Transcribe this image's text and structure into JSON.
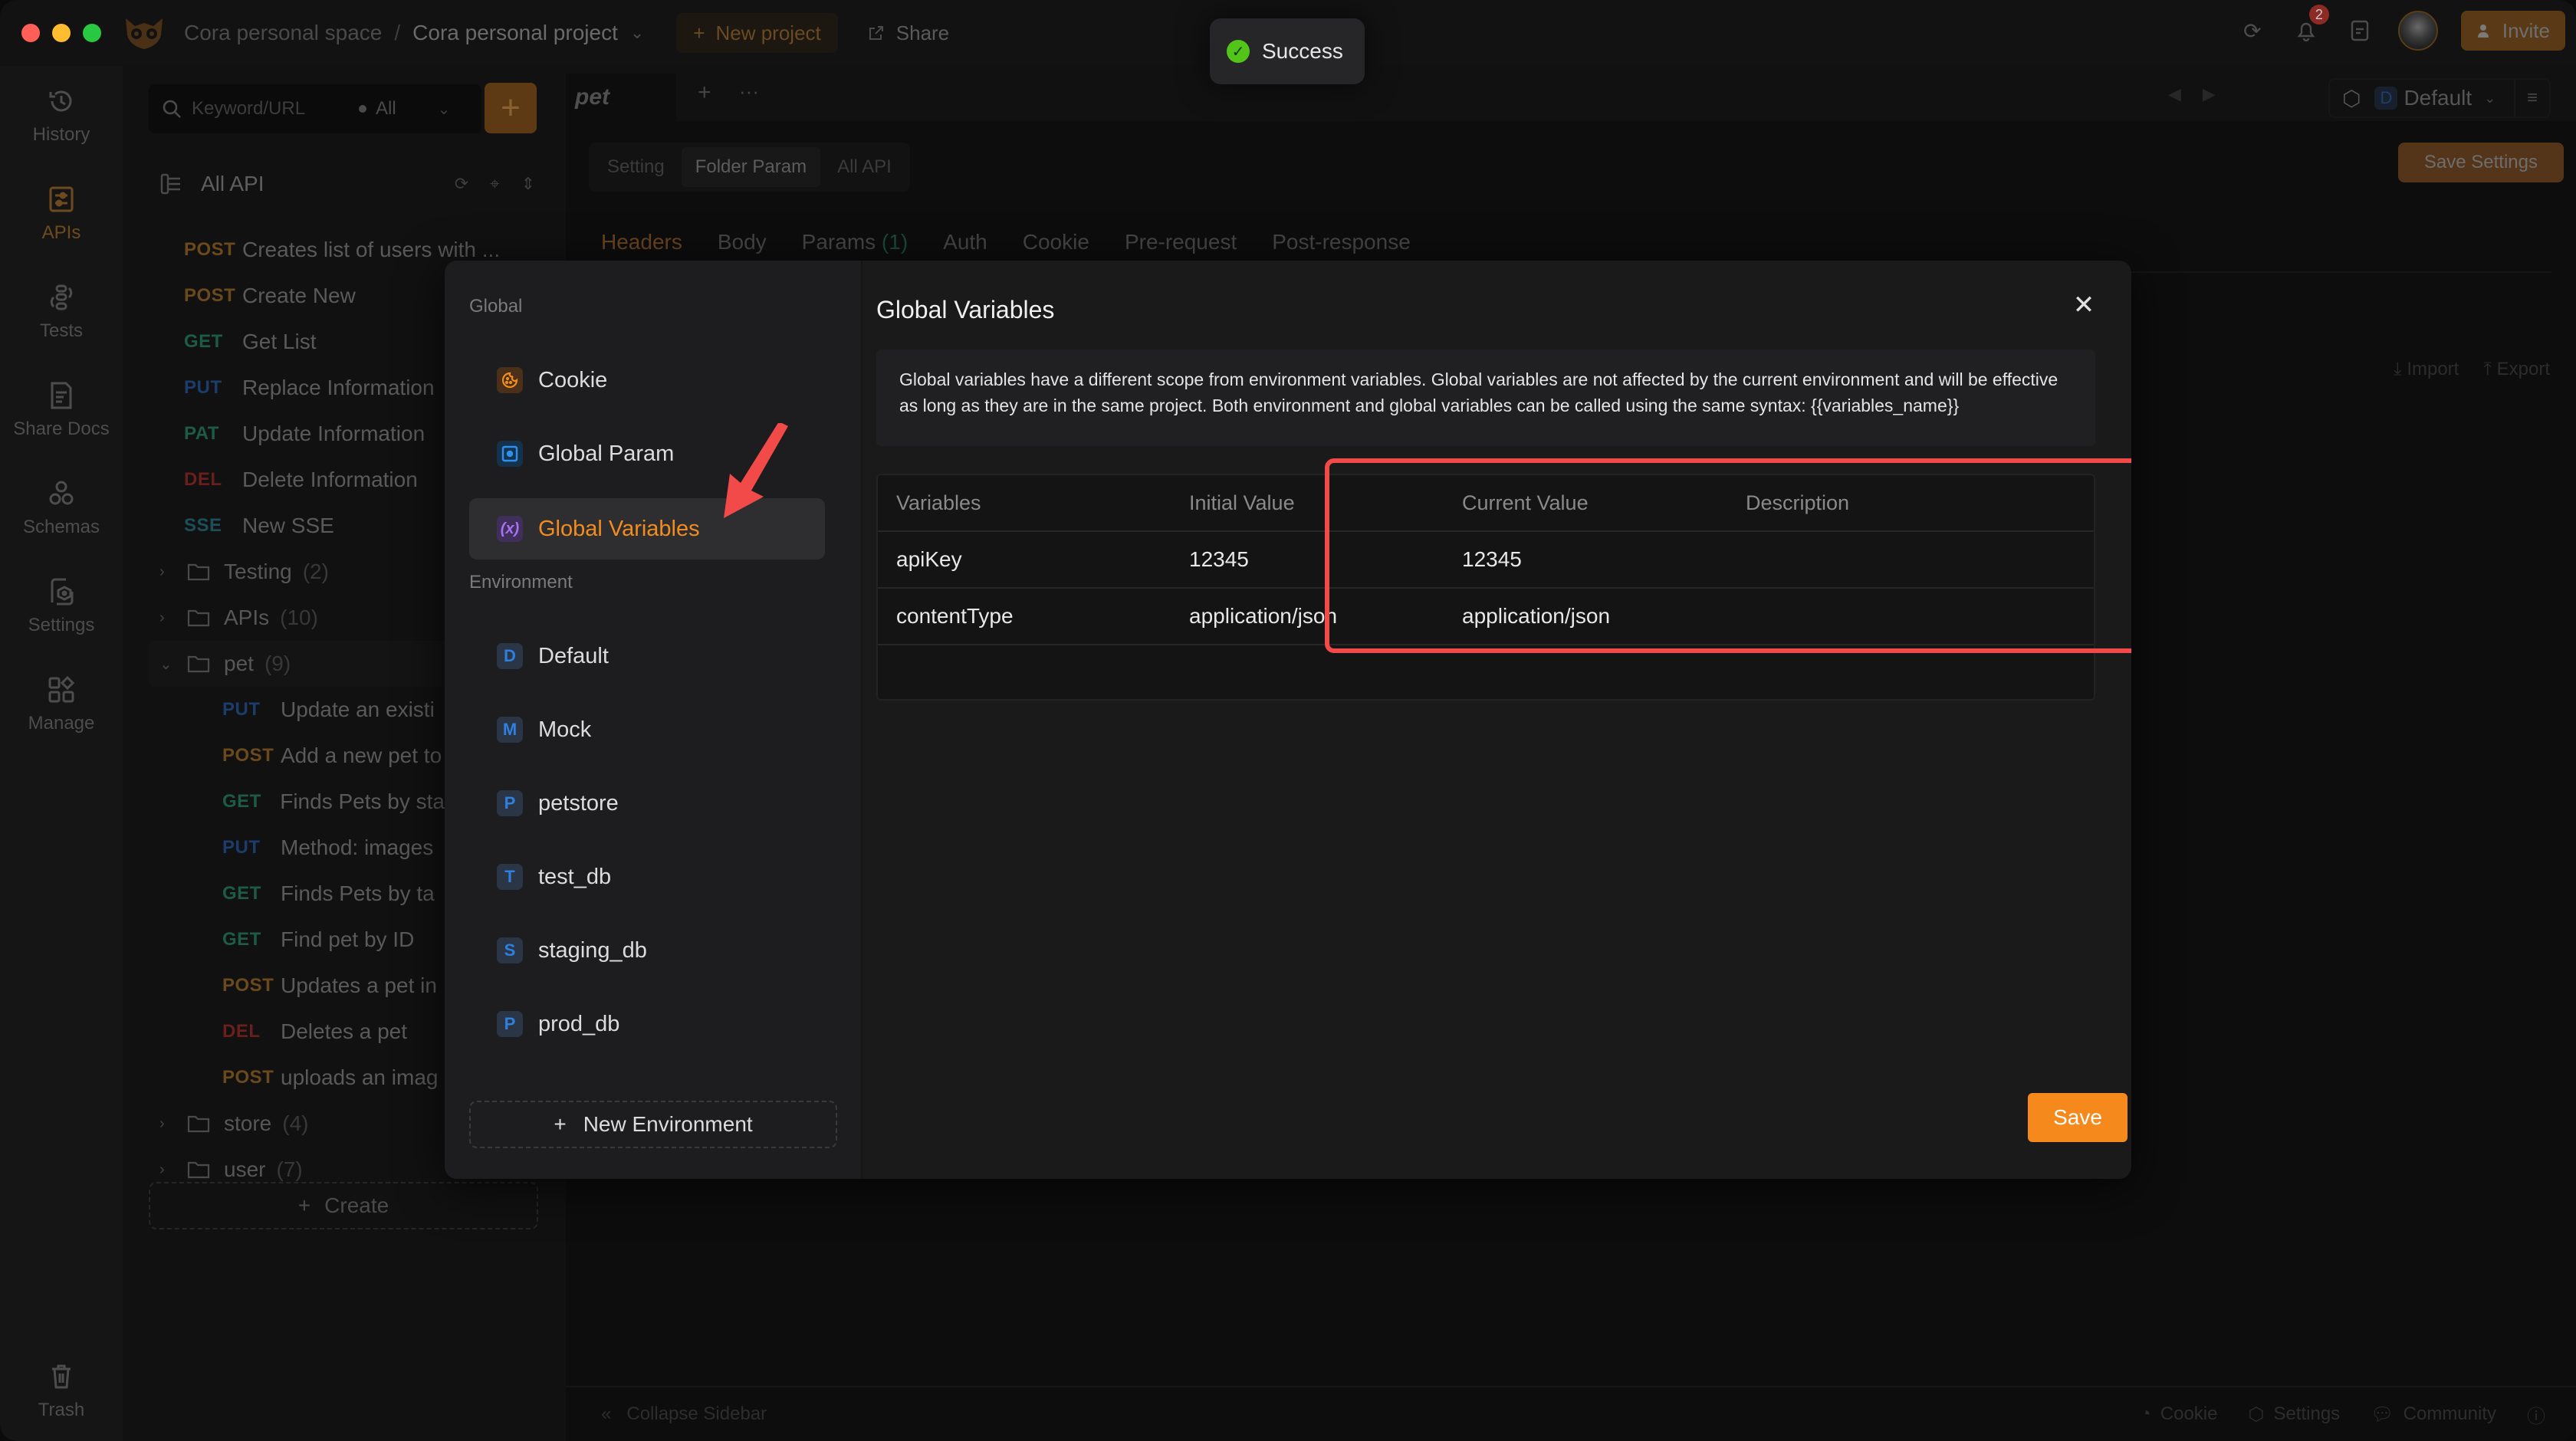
{
  "window": {
    "workspace": "Cora personal space",
    "project": "Cora personal project",
    "new_project_label": "New project",
    "share_label": "Share",
    "notification_count": "2",
    "invite_label": "Invite"
  },
  "toast": {
    "message": "Success",
    "icon": "check-circle-icon"
  },
  "rail": {
    "items": [
      {
        "label": "History",
        "icon": "history-icon"
      },
      {
        "label": "APIs",
        "icon": "apis-icon",
        "active": true
      },
      {
        "label": "Tests",
        "icon": "tests-icon"
      },
      {
        "label": "Share Docs",
        "icon": "share-docs-icon"
      },
      {
        "label": "Schemas",
        "icon": "schemas-icon"
      },
      {
        "label": "Settings",
        "icon": "settings-icon"
      },
      {
        "label": "Manage",
        "icon": "manage-icon"
      }
    ],
    "trash_label": "Trash"
  },
  "sidebar": {
    "search_placeholder": "Keyword/URL",
    "filter_value": "All",
    "root_label": "All API",
    "root_apis": [
      {
        "method": "POST",
        "name": "Creates list of users with ..."
      },
      {
        "method": "POST",
        "name": "Create New"
      },
      {
        "method": "GET",
        "name": "Get List"
      },
      {
        "method": "PUT",
        "name": "Replace Information"
      },
      {
        "method": "PAT",
        "name": "Update Information"
      },
      {
        "method": "DEL",
        "name": "Delete Information"
      },
      {
        "method": "SSE",
        "name": "New SSE"
      }
    ],
    "folders_top": [
      {
        "name": "Testing",
        "count": "(2)"
      },
      {
        "name": "APIs",
        "count": "(10)"
      }
    ],
    "open_folder": {
      "name": "pet",
      "count": "(9)",
      "apis": [
        {
          "method": "PUT",
          "name": "Update an existi"
        },
        {
          "method": "POST",
          "name": "Add a new pet to"
        },
        {
          "method": "GET",
          "name": "Finds Pets by sta"
        },
        {
          "method": "PUT",
          "name": "Method: images"
        },
        {
          "method": "GET",
          "name": "Finds Pets by ta"
        },
        {
          "method": "GET",
          "name": "Find pet by ID"
        },
        {
          "method": "POST",
          "name": "Updates a pet in"
        },
        {
          "method": "DEL",
          "name": "Deletes a pet"
        },
        {
          "method": "POST",
          "name": "uploads an imag"
        }
      ]
    },
    "folders_bottom": [
      {
        "name": "store",
        "count": "(4)"
      },
      {
        "name": "user",
        "count": "(7)"
      }
    ],
    "create_label": "Create"
  },
  "main": {
    "tab_label": "pet",
    "environment": {
      "badge": "D",
      "name": "Default"
    },
    "segments": [
      "Setting",
      "Folder Param",
      "All API"
    ],
    "active_segment": "Folder Param",
    "save_settings_label": "Save Settings",
    "subtabs": [
      {
        "label": "Headers",
        "active": true
      },
      {
        "label": "Body"
      },
      {
        "label": "Params",
        "count": "(1)"
      },
      {
        "label": "Auth"
      },
      {
        "label": "Cookie"
      },
      {
        "label": "Pre-request"
      },
      {
        "label": "Post-response"
      }
    ],
    "import_label": "Import",
    "export_label": "Export",
    "footer": {
      "collapse_label": "Collapse Sidebar",
      "cookie_label": "Cookie",
      "settings_label": "Settings",
      "community_label": "Community"
    }
  },
  "modal": {
    "nav": {
      "global_section": "Global",
      "global_items": [
        {
          "label": "Cookie",
          "icon": "cookie-icon"
        },
        {
          "label": "Global Param",
          "icon": "global-param-icon"
        },
        {
          "label": "Global Variables",
          "icon": "variables-icon",
          "active": true
        }
      ],
      "env_section": "Environment",
      "env_items": [
        {
          "badge": "D",
          "label": "Default"
        },
        {
          "badge": "M",
          "label": "Mock"
        },
        {
          "badge": "P",
          "label": "petstore"
        },
        {
          "badge": "T",
          "label": "test_db"
        },
        {
          "badge": "S",
          "label": "staging_db"
        },
        {
          "badge": "P",
          "label": "prod_db"
        }
      ],
      "new_env_label": "New Environment"
    },
    "title": "Global Variables",
    "info": "Global variables have a different scope from environment variables. Global variables are not affected by the current environment and will be effective as long as they are in the same project. Both environment and global variables can be called using the same syntax: {{variables_name}}",
    "table": {
      "columns": [
        "Variables",
        "Initial Value",
        "Current Value",
        "Description"
      ],
      "rows": [
        [
          "apiKey",
          "12345",
          "12345",
          ""
        ],
        [
          "contentType",
          "application/json",
          "application/json",
          ""
        ]
      ]
    },
    "save_label": "Save"
  },
  "colors": {
    "accent": "#f6891b",
    "highlight": "#f14a48",
    "success": "#52c41a"
  }
}
